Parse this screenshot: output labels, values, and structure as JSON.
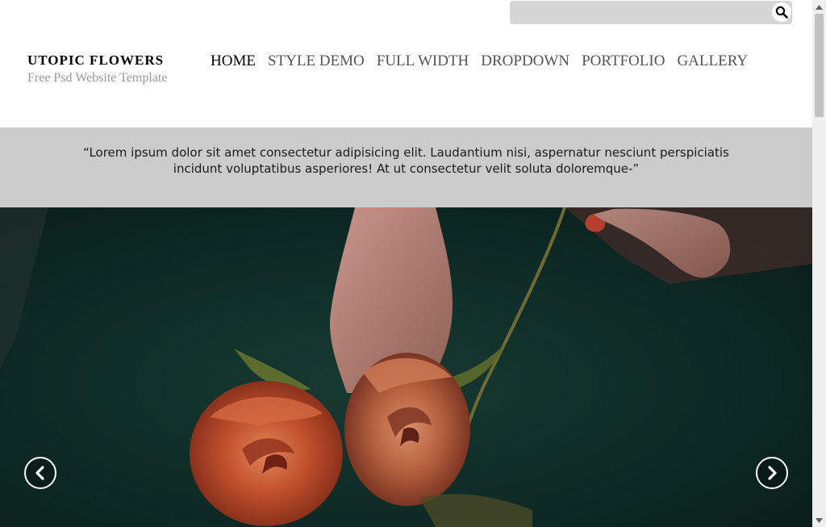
{
  "search": {
    "value": "",
    "placeholder": "",
    "icon": "search-icon"
  },
  "logo": {
    "title": "UTOPIC FLOWERS",
    "subtitle": "Free Psd Website Template"
  },
  "nav": {
    "items": [
      {
        "label": "HOME",
        "active": true
      },
      {
        "label": "STYLE DEMO",
        "active": false
      },
      {
        "label": "FULL WIDTH",
        "active": false
      },
      {
        "label": "DROPDOWN",
        "active": false
      },
      {
        "label": "PORTFOLIO",
        "active": false
      },
      {
        "label": "GALLERY",
        "active": false
      }
    ]
  },
  "quote": {
    "text": "“Lorem ipsum dolor sit amet consectetur adipisicing elit. Laudantium nisi, aspernatur nesciunt perspiciatis incidunt voluptatibus asperiores! At ut consectetur velit soluta doloremque-”"
  },
  "slider": {
    "image": "two-red-roses-held-in-hand",
    "prev_icon": "chevron-left-icon",
    "next_icon": "chevron-right-icon"
  },
  "colors": {
    "quote_band": "#cccccc",
    "search_box": "#d6d6d6",
    "nav_active": "#000000",
    "nav_inactive": "#555555",
    "subtitle": "#9a9a9a"
  }
}
